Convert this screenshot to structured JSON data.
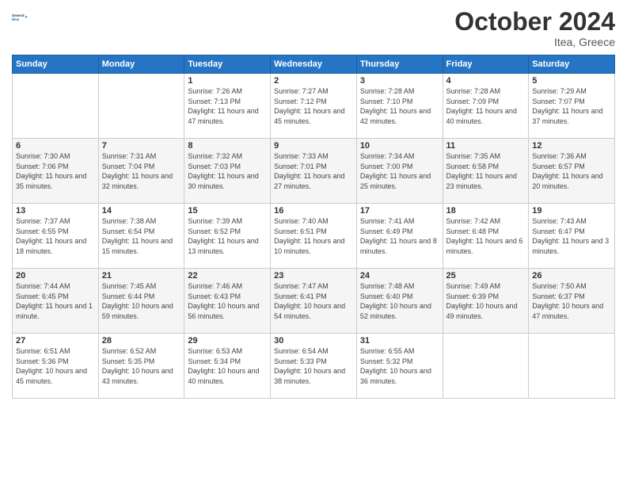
{
  "header": {
    "logo_line1": "General",
    "logo_line2": "Blue",
    "month_title": "October 2024",
    "location": "Itea, Greece"
  },
  "weekdays": [
    "Sunday",
    "Monday",
    "Tuesday",
    "Wednesday",
    "Thursday",
    "Friday",
    "Saturday"
  ],
  "weeks": [
    [
      {
        "day": "",
        "info": ""
      },
      {
        "day": "",
        "info": ""
      },
      {
        "day": "1",
        "info": "Sunrise: 7:26 AM\nSunset: 7:13 PM\nDaylight: 11 hours and 47 minutes."
      },
      {
        "day": "2",
        "info": "Sunrise: 7:27 AM\nSunset: 7:12 PM\nDaylight: 11 hours and 45 minutes."
      },
      {
        "day": "3",
        "info": "Sunrise: 7:28 AM\nSunset: 7:10 PM\nDaylight: 11 hours and 42 minutes."
      },
      {
        "day": "4",
        "info": "Sunrise: 7:28 AM\nSunset: 7:09 PM\nDaylight: 11 hours and 40 minutes."
      },
      {
        "day": "5",
        "info": "Sunrise: 7:29 AM\nSunset: 7:07 PM\nDaylight: 11 hours and 37 minutes."
      }
    ],
    [
      {
        "day": "6",
        "info": "Sunrise: 7:30 AM\nSunset: 7:06 PM\nDaylight: 11 hours and 35 minutes."
      },
      {
        "day": "7",
        "info": "Sunrise: 7:31 AM\nSunset: 7:04 PM\nDaylight: 11 hours and 32 minutes."
      },
      {
        "day": "8",
        "info": "Sunrise: 7:32 AM\nSunset: 7:03 PM\nDaylight: 11 hours and 30 minutes."
      },
      {
        "day": "9",
        "info": "Sunrise: 7:33 AM\nSunset: 7:01 PM\nDaylight: 11 hours and 27 minutes."
      },
      {
        "day": "10",
        "info": "Sunrise: 7:34 AM\nSunset: 7:00 PM\nDaylight: 11 hours and 25 minutes."
      },
      {
        "day": "11",
        "info": "Sunrise: 7:35 AM\nSunset: 6:58 PM\nDaylight: 11 hours and 23 minutes."
      },
      {
        "day": "12",
        "info": "Sunrise: 7:36 AM\nSunset: 6:57 PM\nDaylight: 11 hours and 20 minutes."
      }
    ],
    [
      {
        "day": "13",
        "info": "Sunrise: 7:37 AM\nSunset: 6:55 PM\nDaylight: 11 hours and 18 minutes."
      },
      {
        "day": "14",
        "info": "Sunrise: 7:38 AM\nSunset: 6:54 PM\nDaylight: 11 hours and 15 minutes."
      },
      {
        "day": "15",
        "info": "Sunrise: 7:39 AM\nSunset: 6:52 PM\nDaylight: 11 hours and 13 minutes."
      },
      {
        "day": "16",
        "info": "Sunrise: 7:40 AM\nSunset: 6:51 PM\nDaylight: 11 hours and 10 minutes."
      },
      {
        "day": "17",
        "info": "Sunrise: 7:41 AM\nSunset: 6:49 PM\nDaylight: 11 hours and 8 minutes."
      },
      {
        "day": "18",
        "info": "Sunrise: 7:42 AM\nSunset: 6:48 PM\nDaylight: 11 hours and 6 minutes."
      },
      {
        "day": "19",
        "info": "Sunrise: 7:43 AM\nSunset: 6:47 PM\nDaylight: 11 hours and 3 minutes."
      }
    ],
    [
      {
        "day": "20",
        "info": "Sunrise: 7:44 AM\nSunset: 6:45 PM\nDaylight: 11 hours and 1 minute."
      },
      {
        "day": "21",
        "info": "Sunrise: 7:45 AM\nSunset: 6:44 PM\nDaylight: 10 hours and 59 minutes."
      },
      {
        "day": "22",
        "info": "Sunrise: 7:46 AM\nSunset: 6:43 PM\nDaylight: 10 hours and 56 minutes."
      },
      {
        "day": "23",
        "info": "Sunrise: 7:47 AM\nSunset: 6:41 PM\nDaylight: 10 hours and 54 minutes."
      },
      {
        "day": "24",
        "info": "Sunrise: 7:48 AM\nSunset: 6:40 PM\nDaylight: 10 hours and 52 minutes."
      },
      {
        "day": "25",
        "info": "Sunrise: 7:49 AM\nSunset: 6:39 PM\nDaylight: 10 hours and 49 minutes."
      },
      {
        "day": "26",
        "info": "Sunrise: 7:50 AM\nSunset: 6:37 PM\nDaylight: 10 hours and 47 minutes."
      }
    ],
    [
      {
        "day": "27",
        "info": "Sunrise: 6:51 AM\nSunset: 5:36 PM\nDaylight: 10 hours and 45 minutes."
      },
      {
        "day": "28",
        "info": "Sunrise: 6:52 AM\nSunset: 5:35 PM\nDaylight: 10 hours and 43 minutes."
      },
      {
        "day": "29",
        "info": "Sunrise: 6:53 AM\nSunset: 5:34 PM\nDaylight: 10 hours and 40 minutes."
      },
      {
        "day": "30",
        "info": "Sunrise: 6:54 AM\nSunset: 5:33 PM\nDaylight: 10 hours and 38 minutes."
      },
      {
        "day": "31",
        "info": "Sunrise: 6:55 AM\nSunset: 5:32 PM\nDaylight: 10 hours and 36 minutes."
      },
      {
        "day": "",
        "info": ""
      },
      {
        "day": "",
        "info": ""
      }
    ]
  ]
}
